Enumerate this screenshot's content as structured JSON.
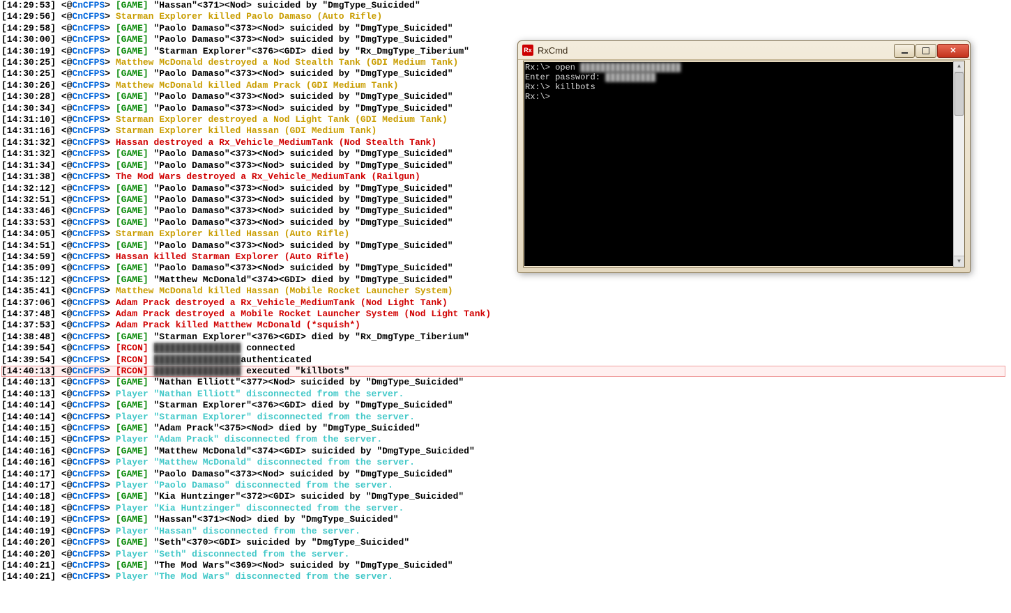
{
  "channel": "CnCFPS",
  "log": [
    {
      "t": "14:29:53",
      "tag": "GAME",
      "c": "black",
      "m": "\"Hassan\"<371><Nod> suicided by \"DmgType_Suicided\""
    },
    {
      "t": "14:29:56",
      "tag": "",
      "c": "gold",
      "m": "Starman Explorer killed Paolo Damaso (Auto Rifle)"
    },
    {
      "t": "14:29:58",
      "tag": "GAME",
      "c": "black",
      "m": "\"Paolo Damaso\"<373><Nod> suicided by \"DmgType_Suicided\""
    },
    {
      "t": "14:30:00",
      "tag": "GAME",
      "c": "black",
      "m": "\"Paolo Damaso\"<373><Nod> suicided by \"DmgType_Suicided\""
    },
    {
      "t": "14:30:19",
      "tag": "GAME",
      "c": "black",
      "m": "\"Starman Explorer\"<376><GDI> died by \"Rx_DmgType_Tiberium\""
    },
    {
      "t": "14:30:25",
      "tag": "",
      "c": "gold",
      "m": "Matthew McDonald destroyed a Nod Stealth Tank (GDI Medium Tank)"
    },
    {
      "t": "14:30:25",
      "tag": "GAME",
      "c": "black",
      "m": "\"Paolo Damaso\"<373><Nod> suicided by \"DmgType_Suicided\""
    },
    {
      "t": "14:30:26",
      "tag": "",
      "c": "gold",
      "m": "Matthew McDonald killed Adam Prack (GDI Medium Tank)"
    },
    {
      "t": "14:30:28",
      "tag": "GAME",
      "c": "black",
      "m": "\"Paolo Damaso\"<373><Nod> suicided by \"DmgType_Suicided\""
    },
    {
      "t": "14:30:34",
      "tag": "GAME",
      "c": "black",
      "m": "\"Paolo Damaso\"<373><Nod> suicided by \"DmgType_Suicided\""
    },
    {
      "t": "14:31:10",
      "tag": "",
      "c": "gold",
      "m": "Starman Explorer destroyed a Nod Light Tank (GDI Medium Tank)"
    },
    {
      "t": "14:31:16",
      "tag": "",
      "c": "gold",
      "m": "Starman Explorer killed Hassan (GDI Medium Tank)"
    },
    {
      "t": "14:31:32",
      "tag": "",
      "c": "red",
      "m": "Hassan destroyed a Rx_Vehicle_MediumTank (Nod Stealth Tank)"
    },
    {
      "t": "14:31:32",
      "tag": "GAME",
      "c": "black",
      "m": "\"Paolo Damaso\"<373><Nod> suicided by \"DmgType_Suicided\""
    },
    {
      "t": "14:31:34",
      "tag": "GAME",
      "c": "black",
      "m": "\"Paolo Damaso\"<373><Nod> suicided by \"DmgType_Suicided\""
    },
    {
      "t": "14:31:38",
      "tag": "",
      "c": "red",
      "m": "The Mod Wars destroyed a Rx_Vehicle_MediumTank (Railgun)"
    },
    {
      "t": "14:32:12",
      "tag": "GAME",
      "c": "black",
      "m": "\"Paolo Damaso\"<373><Nod> suicided by \"DmgType_Suicided\""
    },
    {
      "t": "14:32:51",
      "tag": "GAME",
      "c": "black",
      "m": "\"Paolo Damaso\"<373><Nod> suicided by \"DmgType_Suicided\""
    },
    {
      "t": "14:33:46",
      "tag": "GAME",
      "c": "black",
      "m": "\"Paolo Damaso\"<373><Nod> suicided by \"DmgType_Suicided\""
    },
    {
      "t": "14:33:53",
      "tag": "GAME",
      "c": "black",
      "m": "\"Paolo Damaso\"<373><Nod> suicided by \"DmgType_Suicided\""
    },
    {
      "t": "14:34:05",
      "tag": "",
      "c": "gold",
      "m": "Starman Explorer killed Hassan (Auto Rifle)"
    },
    {
      "t": "14:34:51",
      "tag": "GAME",
      "c": "black",
      "m": "\"Paolo Damaso\"<373><Nod> suicided by \"DmgType_Suicided\""
    },
    {
      "t": "14:34:59",
      "tag": "",
      "c": "red",
      "m": "Hassan killed Starman Explorer (Auto Rifle)"
    },
    {
      "t": "14:35:09",
      "tag": "GAME",
      "c": "black",
      "m": "\"Paolo Damaso\"<373><Nod> suicided by \"DmgType_Suicided\""
    },
    {
      "t": "14:35:12",
      "tag": "GAME",
      "c": "black",
      "m": "\"Matthew McDonald\"<374><GDI> died by \"DmgType_Suicided\""
    },
    {
      "t": "14:35:41",
      "tag": "",
      "c": "gold",
      "m": "Matthew McDonald killed Hassan (Mobile Rocket Launcher System)"
    },
    {
      "t": "14:37:06",
      "tag": "",
      "c": "red",
      "m": "Adam Prack destroyed a Rx_Vehicle_MediumTank (Nod Light Tank)"
    },
    {
      "t": "14:37:48",
      "tag": "",
      "c": "red",
      "m": "Adam Prack destroyed a Mobile Rocket Launcher System (Nod Light Tank)"
    },
    {
      "t": "14:37:53",
      "tag": "",
      "c": "red",
      "m": "Adam Prack killed Matthew McDonald (*squish*)"
    },
    {
      "t": "14:38:48",
      "tag": "GAME",
      "c": "black",
      "m": "\"Starman Explorer\"<376><GDI> died by \"Rx_DmgType_Tiberium\""
    },
    {
      "t": "14:39:54",
      "tag": "RCON",
      "c": "black",
      "blur": "████████████████",
      "m": " connected"
    },
    {
      "t": "14:39:54",
      "tag": "RCON",
      "c": "black",
      "blur": "████████████████",
      "m": "authenticated"
    },
    {
      "t": "14:40:13",
      "tag": "RCON",
      "c": "black",
      "blur": "████████████████",
      "m": " executed \"killbots\"",
      "hl": true
    },
    {
      "t": "14:40:13",
      "tag": "GAME",
      "c": "black",
      "m": "\"Nathan Elliott\"<377><Nod> suicided by \"DmgType_Suicided\""
    },
    {
      "t": "14:40:13",
      "tag": "",
      "c": "cyan",
      "m": "Player \"Nathan Elliott\" disconnected from the server."
    },
    {
      "t": "14:40:14",
      "tag": "GAME",
      "c": "black",
      "m": "\"Starman Explorer\"<376><GDI> died by \"DmgType_Suicided\""
    },
    {
      "t": "14:40:14",
      "tag": "",
      "c": "cyan",
      "m": "Player \"Starman Explorer\" disconnected from the server."
    },
    {
      "t": "14:40:15",
      "tag": "GAME",
      "c": "black",
      "m": "\"Adam Prack\"<375><Nod> died by \"DmgType_Suicided\""
    },
    {
      "t": "14:40:15",
      "tag": "",
      "c": "cyan",
      "m": "Player \"Adam Prack\" disconnected from the server."
    },
    {
      "t": "14:40:16",
      "tag": "GAME",
      "c": "black",
      "m": "\"Matthew McDonald\"<374><GDI> suicided by \"DmgType_Suicided\""
    },
    {
      "t": "14:40:16",
      "tag": "",
      "c": "cyan",
      "m": "Player \"Matthew McDonald\" disconnected from the server."
    },
    {
      "t": "14:40:17",
      "tag": "GAME",
      "c": "black",
      "m": "\"Paolo Damaso\"<373><Nod> suicided by \"DmgType_Suicided\""
    },
    {
      "t": "14:40:17",
      "tag": "",
      "c": "cyan",
      "m": "Player \"Paolo Damaso\" disconnected from the server."
    },
    {
      "t": "14:40:18",
      "tag": "GAME",
      "c": "black",
      "m": "\"Kia Huntzinger\"<372><GDI> suicided by \"DmgType_Suicided\""
    },
    {
      "t": "14:40:18",
      "tag": "",
      "c": "cyan",
      "m": "Player \"Kia Huntzinger\" disconnected from the server."
    },
    {
      "t": "14:40:19",
      "tag": "GAME",
      "c": "black",
      "m": "\"Hassan\"<371><Nod> died by \"DmgType_Suicided\""
    },
    {
      "t": "14:40:19",
      "tag": "",
      "c": "cyan",
      "m": "Player \"Hassan\" disconnected from the server."
    },
    {
      "t": "14:40:20",
      "tag": "GAME",
      "c": "black",
      "m": "\"Seth\"<370><GDI> suicided by \"DmgType_Suicided\""
    },
    {
      "t": "14:40:20",
      "tag": "",
      "c": "cyan",
      "m": "Player \"Seth\" disconnected from the server."
    },
    {
      "t": "14:40:21",
      "tag": "GAME",
      "c": "black",
      "m": "\"The Mod Wars\"<369><Nod> suicided by \"DmgType_Suicided\""
    },
    {
      "t": "14:40:21",
      "tag": "",
      "c": "cyan",
      "m": "Player \"The Mod Wars\" disconnected from the server."
    }
  ],
  "rxcmd": {
    "title": "RxCmd",
    "lines": [
      {
        "prompt": "Rx:\\> ",
        "cmd": "open ",
        "blur": "████████████████████"
      },
      {
        "prompt": "Enter password: ",
        "cmd": "",
        "blur": "██████████"
      },
      {
        "prompt": "Rx:\\> ",
        "cmd": "killbots",
        "blur": ""
      },
      {
        "prompt": "Rx:\\>",
        "cmd": "",
        "blur": ""
      }
    ]
  }
}
